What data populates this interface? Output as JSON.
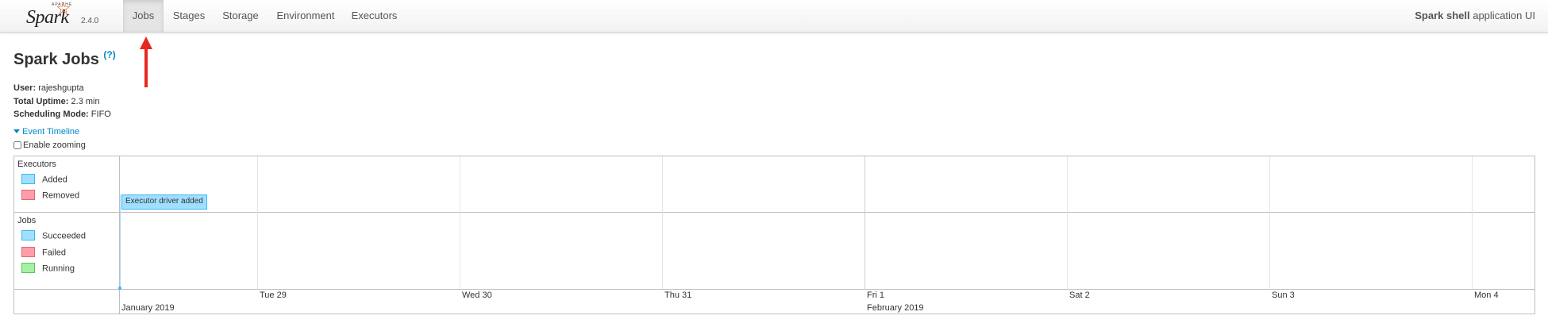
{
  "navbar": {
    "brand": {
      "apache": "APACHE",
      "name": "Spark",
      "version": "2.4.0"
    },
    "tabs": [
      {
        "label": "Jobs",
        "active": true
      },
      {
        "label": "Stages"
      },
      {
        "label": "Storage"
      },
      {
        "label": "Environment"
      },
      {
        "label": "Executors"
      }
    ],
    "app_name": "Spark shell",
    "app_suffix": " application UI"
  },
  "page": {
    "title": "Spark Jobs",
    "help": "(?)",
    "summary": {
      "user_label": "User:",
      "user": "rajeshgupta",
      "uptime_label": "Total Uptime:",
      "uptime": "2.3 min",
      "mode_label": "Scheduling Mode:",
      "mode": "FIFO"
    },
    "timeline_toggle": "Event Timeline",
    "zoom_label": "Enable zooming"
  },
  "timeline": {
    "executors_title": "Executors",
    "executors_legend": [
      {
        "label": "Added",
        "fill": "#a0dfff",
        "border": "#3eb7ef"
      },
      {
        "label": "Removed",
        "fill": "#ff9eaa",
        "border": "#e36578"
      }
    ],
    "jobs_title": "Jobs",
    "jobs_legend": [
      {
        "label": "Succeeded",
        "fill": "#a0dfff",
        "border": "#3eb7ef"
      },
      {
        "label": "Failed",
        "fill": "#ff9eaa",
        "border": "#e36578"
      },
      {
        "label": "Running",
        "fill": "#a5f0a5",
        "border": "#5bc55b"
      }
    ],
    "event_label": "Executor driver added",
    "ticks": [
      "Tue 29",
      "Wed 30",
      "Thu 31",
      "Fri 1",
      "Sat 2",
      "Sun 3",
      "Mon 4"
    ],
    "major_labels": [
      "January 2019",
      "February 2019"
    ]
  },
  "annotation": {
    "arrow_color": "#e8271c"
  }
}
